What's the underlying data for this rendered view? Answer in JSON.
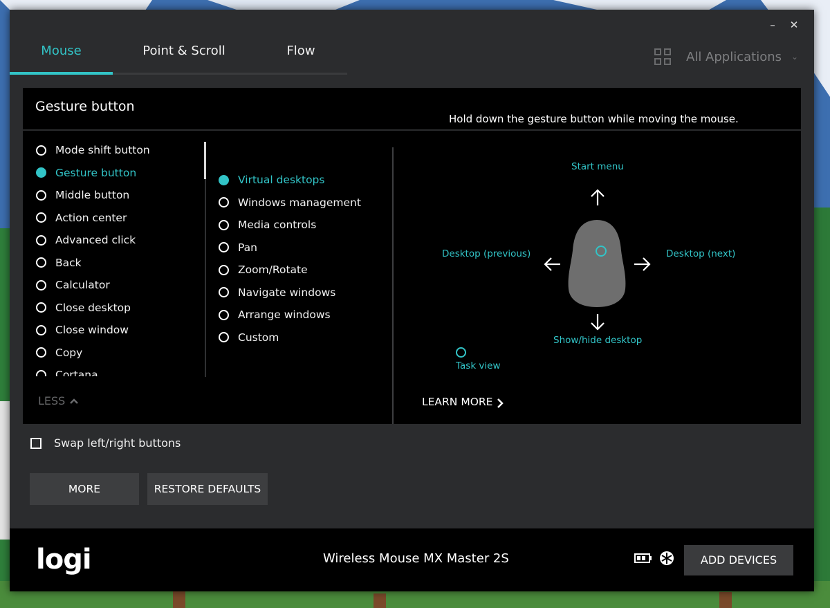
{
  "window": {
    "minimize_glyph": "–",
    "close_glyph": "✕"
  },
  "tabs": [
    {
      "label": "Mouse",
      "active": true
    },
    {
      "label": "Point & Scroll",
      "active": false
    },
    {
      "label": "Flow",
      "active": false
    }
  ],
  "app_selector": {
    "label": "All Applications",
    "icon": "grid-icon",
    "chevron": "⌄"
  },
  "panel": {
    "title": "Gesture button",
    "hint": "Hold down the gesture button while moving the mouse."
  },
  "button_list": [
    {
      "label": "Mode shift button",
      "selected": false
    },
    {
      "label": "Gesture button",
      "selected": true
    },
    {
      "label": "Middle button",
      "selected": false
    },
    {
      "label": "Action center",
      "selected": false
    },
    {
      "label": "Advanced click",
      "selected": false
    },
    {
      "label": "Back",
      "selected": false
    },
    {
      "label": "Calculator",
      "selected": false
    },
    {
      "label": "Close desktop",
      "selected": false
    },
    {
      "label": "Close window",
      "selected": false
    },
    {
      "label": "Copy",
      "selected": false
    },
    {
      "label": "Cortana",
      "selected": false
    }
  ],
  "gesture_options": [
    {
      "label": "Virtual desktops",
      "selected": true
    },
    {
      "label": "Windows management",
      "selected": false
    },
    {
      "label": "Media controls",
      "selected": false
    },
    {
      "label": "Pan",
      "selected": false
    },
    {
      "label": "Zoom/Rotate",
      "selected": false
    },
    {
      "label": "Navigate windows",
      "selected": false
    },
    {
      "label": "Arrange windows",
      "selected": false
    },
    {
      "label": "Custom",
      "selected": false
    }
  ],
  "less_label": "LESS",
  "gestures": {
    "up": "Start menu",
    "left": "Desktop (previous)",
    "right": "Desktop (next)",
    "down": "Show/hide desktop",
    "click": "Task view"
  },
  "learn_more": "LEARN MORE",
  "swap_label": "Swap left/right buttons",
  "swap_checked": false,
  "buttons": {
    "more": "MORE",
    "restore": "RESTORE DEFAULTS",
    "add_devices": "ADD DEVICES"
  },
  "footer": {
    "logo": "logi",
    "device_name": "Wireless Mouse MX Master 2S"
  },
  "colors": {
    "accent": "#32c4c7",
    "window_bg": "#2b2c2e",
    "panel_bg": "#000000"
  }
}
